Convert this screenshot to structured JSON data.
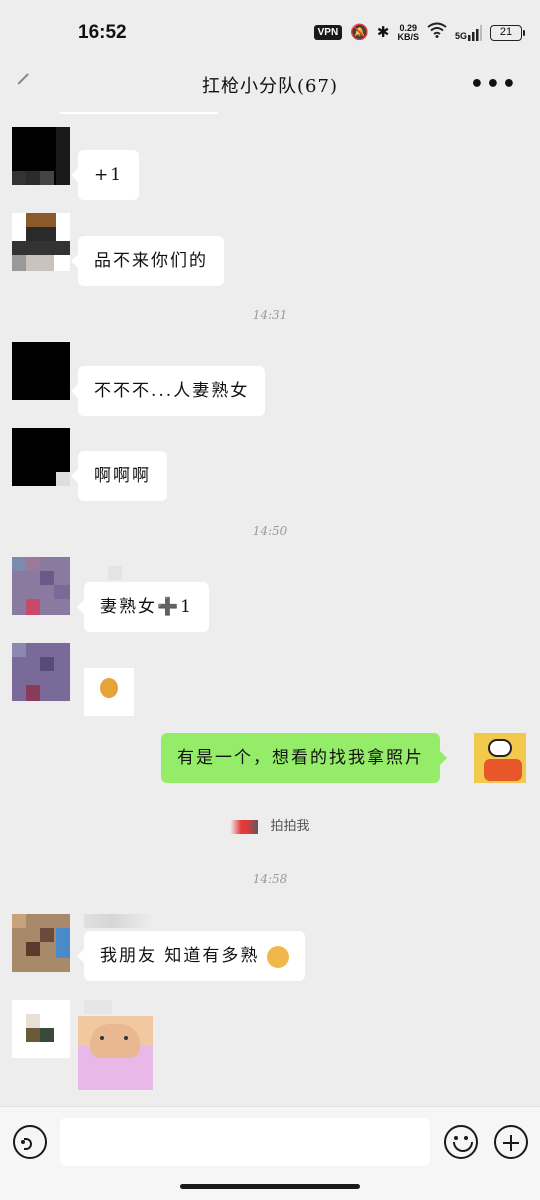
{
  "status_bar": {
    "time": "16:52",
    "vpn": "VPN",
    "speed_value": "0.29",
    "speed_unit": "KB/S",
    "network": "5G",
    "battery": "21"
  },
  "header": {
    "title": "扛枪小分队(67)",
    "more_label": "•••"
  },
  "messages": [
    {
      "text": "+1"
    },
    {
      "text": "品不来你们的"
    },
    {
      "text": "不不不...人妻熟女"
    },
    {
      "text": "啊啊啊"
    },
    {
      "text": "妻熟女➕1"
    },
    {
      "text": "有是一个，想看的找我拿照片"
    },
    {
      "text": "我朋友 知道有多熟"
    }
  ],
  "timestamps": [
    "14:31",
    "14:50",
    "14:58"
  ],
  "pat_text": "拍拍我",
  "colors": {
    "background": "#ededed",
    "own_bubble": "#95ec69",
    "other_bubble": "#ffffff"
  },
  "icons": {
    "voice": "voice-icon",
    "emoji": "emoji-icon",
    "plus": "plus-icon",
    "back": "back-icon",
    "more": "more-icon"
  }
}
